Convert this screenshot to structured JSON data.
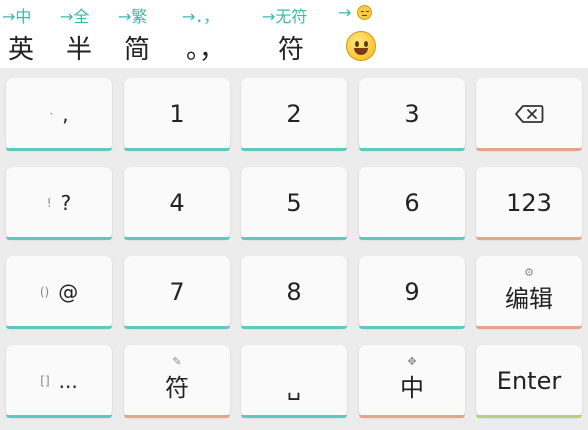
{
  "hints": [
    "→中",
    "→全",
    "→繁",
    "→．，",
    "→无符",
    "→"
  ],
  "hint_emoji": "pensive-face",
  "status": {
    "lang": "英",
    "width": "半",
    "charset": "简",
    "punct": "。，",
    "symbol": "符",
    "emoji": "grinning-face"
  },
  "keys": {
    "comma_pre": "·",
    "comma": ",",
    "one": "1",
    "two": "2",
    "three": "3",
    "excl_pre": "!",
    "question": "?",
    "four": "4",
    "five": "5",
    "six": "6",
    "num_mode": "123",
    "paren_pre": "()",
    "at": "@",
    "seven": "7",
    "eight": "8",
    "nine": "9",
    "edit_sub": "⚙",
    "edit": "编辑",
    "bracket_pre": "[]",
    "ellipsis": "...",
    "symbol_sub": "✎",
    "symbol": "符",
    "space": "␣",
    "lang_sub": "✥",
    "lang": "中",
    "enter": "Enter"
  },
  "colors": {
    "accent_teal": "#5fc9c0",
    "accent_orange": "#e8a38e",
    "accent_green": "#b6d07a",
    "hint_text": "#3fb7ad"
  }
}
